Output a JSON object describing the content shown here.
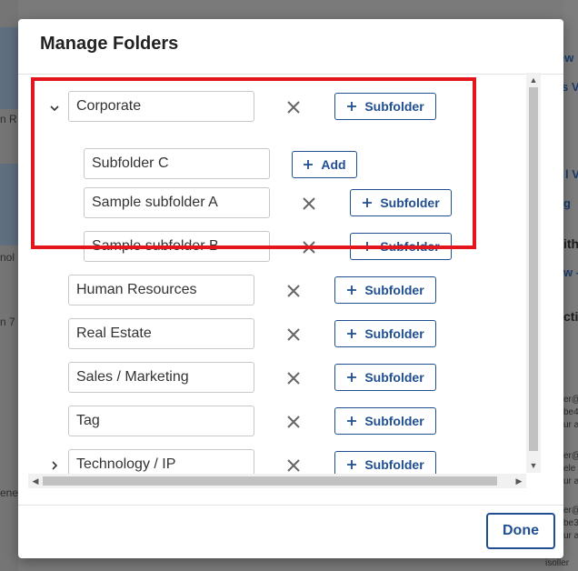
{
  "modal": {
    "title": "Manage Folders",
    "done_label": "Done"
  },
  "folders": [
    {
      "name": "Corporate",
      "expanded": true,
      "button": "Subfolder"
    },
    {
      "name": "Subfolder C",
      "button": "Add",
      "editing": true
    },
    {
      "name": "Sample subfolder A",
      "button": "Subfolder"
    },
    {
      "name": "Sample subfolder B",
      "button": "Subfolder"
    },
    {
      "name": "Human Resources",
      "button": "Subfolder"
    },
    {
      "name": "Real Estate",
      "button": "Subfolder"
    },
    {
      "name": "Sales / Marketing",
      "button": "Subfolder"
    },
    {
      "name": "Tag",
      "button": "Subfolder"
    },
    {
      "name": "Technology / IP",
      "collapsed": true,
      "button": "Subfolder"
    }
  ],
  "background": {
    "right_texts": [
      "ew",
      "s V",
      "l Vi",
      "g",
      "ith",
      "w -",
      "ctiv",
      "er@",
      "be4",
      "ur a",
      "er@",
      "ele",
      "ur a",
      "er@",
      "be3",
      "ur a",
      "isoller"
    ],
    "left_texts": [
      "n R",
      "nol",
      "n 7",
      "ene"
    ],
    "colors": {
      "accent": "#1f4f91",
      "highlight": "#e3151d"
    }
  }
}
